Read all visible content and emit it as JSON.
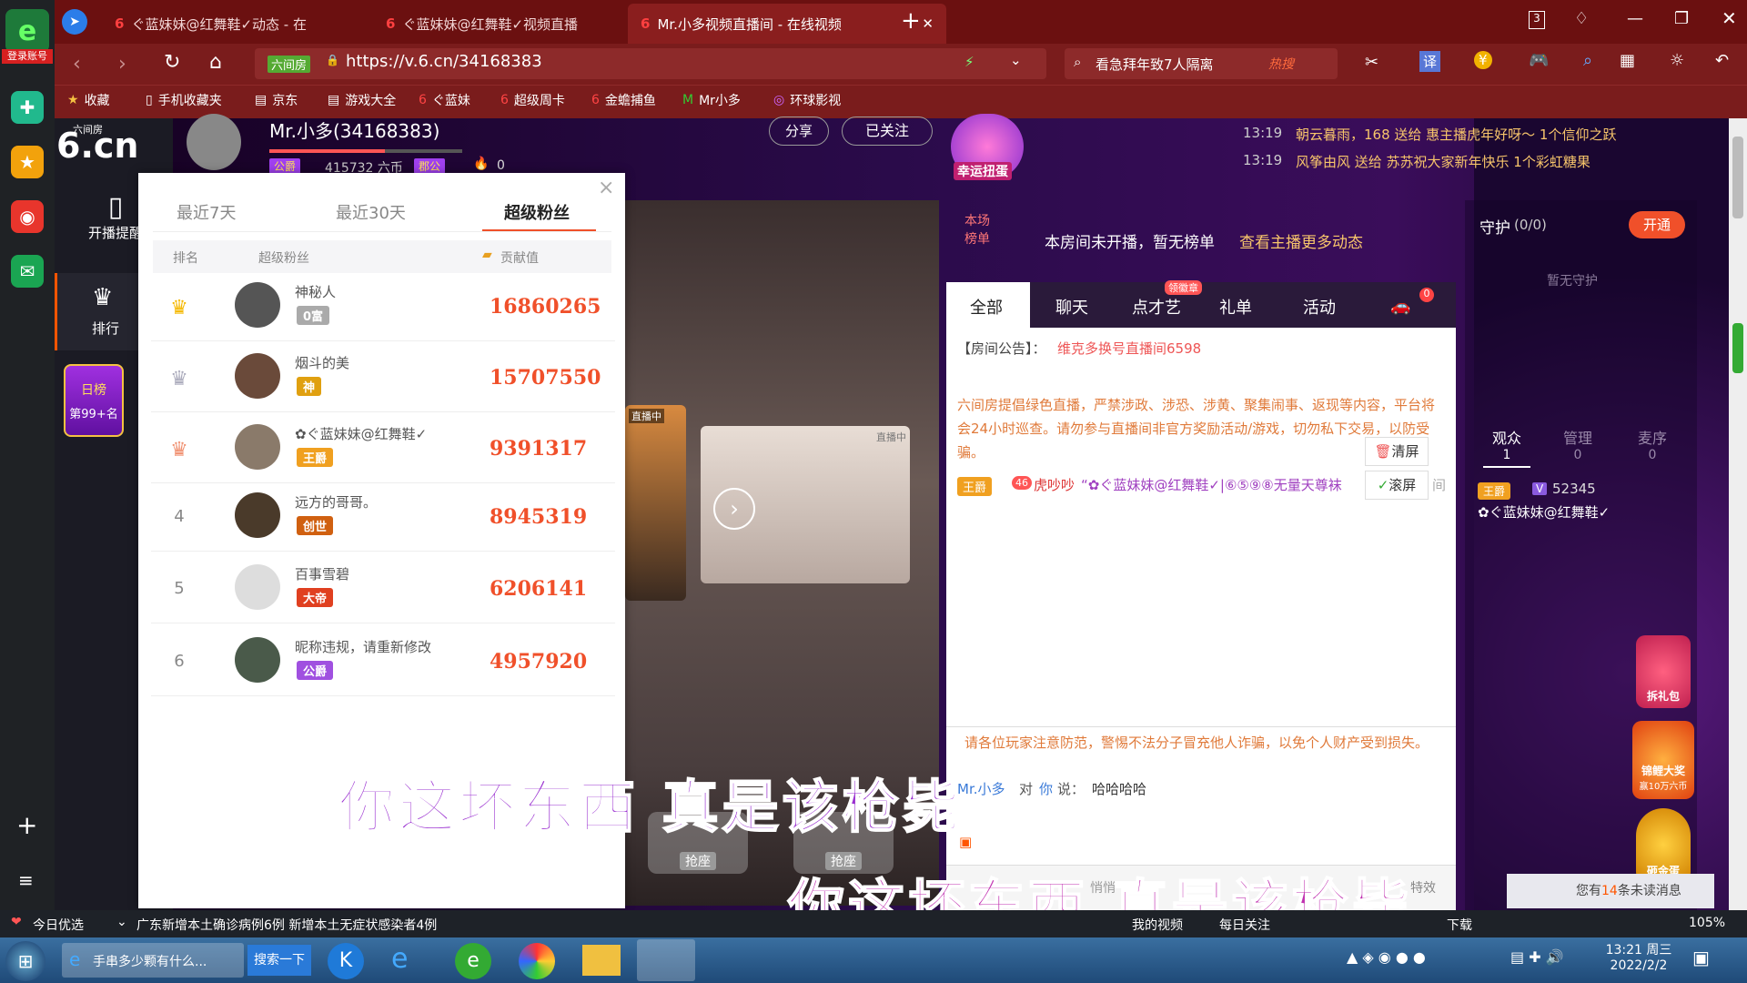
{
  "browser": {
    "login_label": "登录账号",
    "tabs": [
      {
        "label": "ぐ蓝妹妹@红舞鞋✓动态 - 在"
      },
      {
        "label": "ぐ蓝妹妹@红舞鞋✓视频直播"
      },
      {
        "label": "Mr.小多视频直播间 - 在线视频"
      }
    ],
    "tab_count": "3",
    "url_prefix": "六间房",
    "url": "https://v.6.cn/34168383",
    "search_placeholder": "看急拜年致7人隔离",
    "hot_label": "热搜",
    "favorites": [
      "收藏",
      "手机收藏夹",
      "京东",
      "游戏大全",
      "ぐ蓝妹",
      "超级周卡",
      "金蟾捕鱼",
      "Mr小多",
      "环球影视"
    ]
  },
  "leftbar": {
    "add": "+",
    "menu": "≡"
  },
  "site": {
    "logo_small": "六间房",
    "logo": "6.cn",
    "nav_remind": "开播提醒",
    "nav_rank": "排行",
    "daily_rank": "日榜",
    "daily_rank_pos": "第99+名",
    "anchor_name": "Mr.小多(34168383)",
    "anchor_coins": "415732 六币",
    "anchor_badge1": "公爵",
    "anchor_badge2": "郡公",
    "anchor_fans": "0",
    "share": "分享",
    "followed": "已关注",
    "lucky_egg": "幸运扭蛋"
  },
  "ticker": [
    {
      "time": "13:19",
      "text": "朝云暮雨，168 送给 惠主播虎年好呀～ 1个信仰之跃"
    },
    {
      "time": "13:19",
      "text": "风筝由风 送给 苏苏祝大家新年快乐 1个彩虹糖果"
    }
  ],
  "popup": {
    "tabs": [
      "最近7天",
      "最近30天",
      "超级粉丝"
    ],
    "col_rank": "排名",
    "col_fan": "超级粉丝",
    "col_value": "贡献值",
    "rows": [
      {
        "rank": "1",
        "name": "神秘人",
        "badge": "0富",
        "value": "16860265"
      },
      {
        "rank": "2",
        "name": "烟斗的美",
        "badge": "神",
        "value": "15707550"
      },
      {
        "rank": "3",
        "name": "✿ぐ蓝妹妹@红舞鞋✓",
        "badge": "王爵",
        "value": "9391317"
      },
      {
        "rank": "4",
        "name": "远方的哥哥。",
        "badge": "创世",
        "value": "8945319"
      },
      {
        "rank": "5",
        "name": "百事雪碧",
        "badge": "大帝",
        "value": "6206141"
      },
      {
        "rank": "6",
        "name": "昵称违规，请重新修改",
        "badge": "公爵",
        "value": "4957920"
      }
    ],
    "close": "×"
  },
  "video": {
    "live_tag": "直播中",
    "seat": "抢座"
  },
  "rankboard": {
    "label": "本场榜单",
    "notice": "本房间未开播，暂无榜单",
    "more": "查看主播更多动态"
  },
  "chat": {
    "tabs": [
      "全部",
      "聊天",
      "点才艺",
      "礼单",
      "活动"
    ],
    "tab_badge": "领徽章",
    "car_count": "0",
    "announce_label": "【房间公告】：",
    "announce_text": "维克多换号直播间6598",
    "rules": "六间房提倡绿色直播，严禁涉政、涉恐、涉黄、聚集闹事、返现等内容，平台将会24小时巡查。请勿参与直播间非官方奖励活动/游戏，切勿私下交易，以防受骗。",
    "clear": "清屏",
    "scroll": "滚屏",
    "msg_badge": "王爵",
    "msg_level": "46",
    "msg_user": "虎吵吵",
    "msg_text": "“✿ぐ蓝妹妹@红舞鞋✓|⑥⑤⑨⑧无量天尊袜",
    "msg_tail": "间",
    "warning": "请各位玩家注意防范，警惕不法分子冒充他人诈骗，以免个人财产受到损失。",
    "said_user": "Mr.小多",
    "said_to": "对",
    "said_target": "你",
    "said_verb": "说：",
    "said_text": "哈哈哈哈",
    "input_hint": "悄悄",
    "effects": "特效"
  },
  "guard": {
    "title": "守护",
    "count": "(0/0)",
    "open": "开通",
    "empty": "暂无守护",
    "tabs": [
      {
        "label": "观众",
        "n": "1"
      },
      {
        "label": "管理",
        "n": "0"
      },
      {
        "label": "麦序",
        "n": "0"
      }
    ],
    "viewer_badge": "王爵",
    "viewer_v": "V",
    "viewer_num": "52345",
    "viewer_name": "✿ぐ蓝妹妹@红舞鞋✓",
    "gift": "拆礼包",
    "koi": "锦鲤大奖",
    "koi_sub": "赢10万六币",
    "gold": "砸金蛋",
    "unread_pre": "您有",
    "unread_n": "14",
    "unread_post": "条未读消息"
  },
  "subtitles": {
    "line": "你这坏东西 真是该枪毙"
  },
  "status": {
    "today": "今日优选",
    "news": "广东新增本土确诊病例6例 新增本土无症状感染者4例",
    "myvideo": "我的视频",
    "daily": "每日关注",
    "download": "下载",
    "zoom": "105%"
  },
  "taskbar": {
    "ie_task": "手串多少颗有什么...",
    "search_btn": "搜索一下",
    "time": "13:21 周三",
    "date": "2022/2/2"
  }
}
